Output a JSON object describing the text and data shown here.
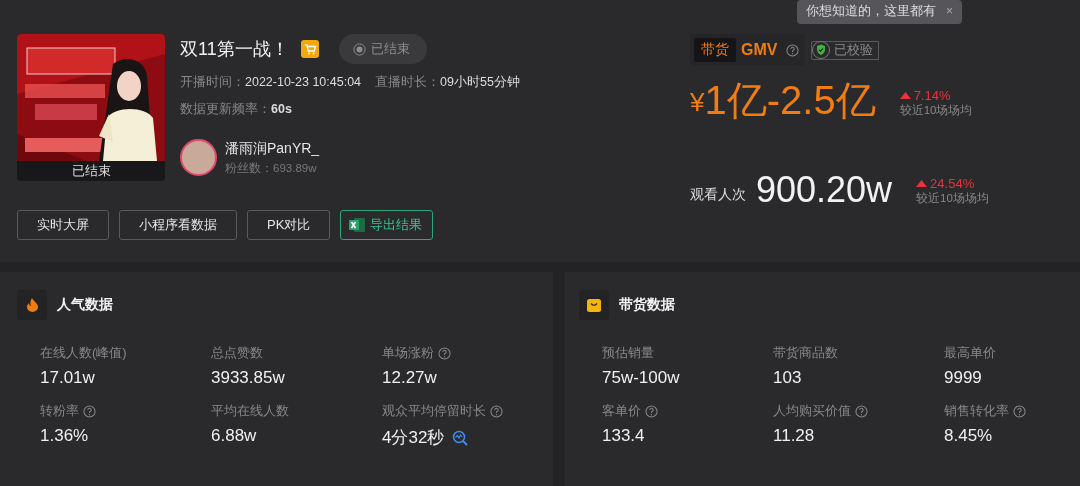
{
  "tooltip": {
    "text": "你想知道的，这里都有",
    "close": "×"
  },
  "live": {
    "cover_status": "已结束",
    "title": "双11第一战！",
    "status": "已结束",
    "start_label": "开播时间：",
    "start_time": "2022-10-23 10:45:04",
    "duration_label": "直播时长：",
    "duration": "09小时55分钟",
    "refresh_label": "数据更新频率：",
    "refresh": "60s",
    "host_name": "潘雨润PanYR_",
    "fans_label": "粉丝数：",
    "fans": "693.89w"
  },
  "actions": [
    {
      "label": "实时大屏",
      "kind": "plain"
    },
    {
      "label": "小程序看数据",
      "kind": "plain"
    },
    {
      "label": "PK对比",
      "kind": "plain"
    },
    {
      "label": "导出结果",
      "kind": "excel"
    }
  ],
  "gmv": {
    "tag": "带货",
    "label": "GMV",
    "verified": "已校验",
    "currency": "¥",
    "value": "1亿-2.5亿",
    "change": "7.14%",
    "change_note": "较近10场场均"
  },
  "views": {
    "label": "观看人次",
    "value": "900.20w",
    "change": "24.54%",
    "change_note": "较近10场场均"
  },
  "panels": [
    {
      "kind": "popularity",
      "title": "人气数据",
      "metrics": [
        {
          "label": "在线人数(峰值)",
          "value": "17.01w",
          "help": false,
          "trend": false
        },
        {
          "label": "总点赞数",
          "value": "3933.85w",
          "help": false,
          "trend": false
        },
        {
          "label": "单场涨粉",
          "value": "12.27w",
          "help": true,
          "trend": false
        },
        {
          "label": "转粉率",
          "value": "1.36%",
          "help": true,
          "trend": false
        },
        {
          "label": "平均在线人数",
          "value": "6.88w",
          "help": false,
          "trend": false
        },
        {
          "label": "观众平均停留时长",
          "value": "4分32秒",
          "help": true,
          "trend": true
        }
      ]
    },
    {
      "kind": "sales",
      "title": "带货数据",
      "metrics": [
        {
          "label": "预估销量",
          "value": "75w-100w",
          "help": false,
          "trend": false
        },
        {
          "label": "带货商品数",
          "value": "103",
          "help": false,
          "trend": false
        },
        {
          "label": "最高单价",
          "value": "9999",
          "help": false,
          "trend": false
        },
        {
          "label": "客单价",
          "value": "133.4",
          "help": true,
          "trend": false
        },
        {
          "label": "人均购买价值",
          "value": "11.28",
          "help": true,
          "trend": false
        },
        {
          "label": "销售转化率",
          "value": "8.45%",
          "help": true,
          "trend": false
        }
      ]
    }
  ]
}
